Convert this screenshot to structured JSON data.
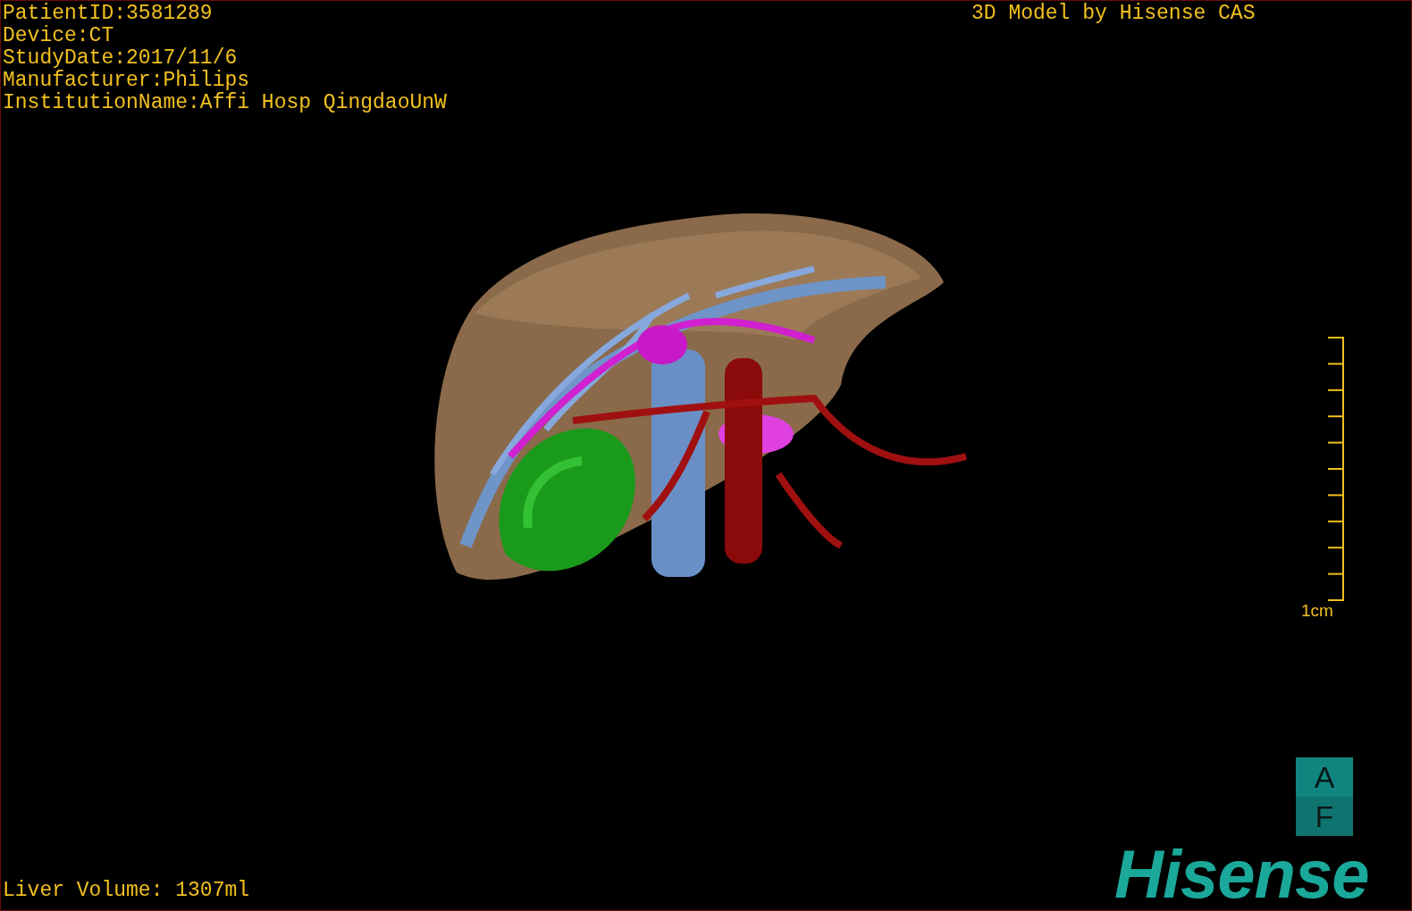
{
  "patient_info": [
    "PatientID:3581289",
    "Device:CT",
    "StudyDate:2017/11/6",
    "Manufacturer:Philips",
    "InstitutionName:Affi Hosp QingdaoUnW"
  ],
  "title": "3D Model by Hisense CAS",
  "scale_bar": {
    "label": "1cm"
  },
  "orientation_cube": {
    "top": "A",
    "bottom": "F"
  },
  "logo": "Hisense",
  "liver_volume": "Liver Volume: 1307ml"
}
